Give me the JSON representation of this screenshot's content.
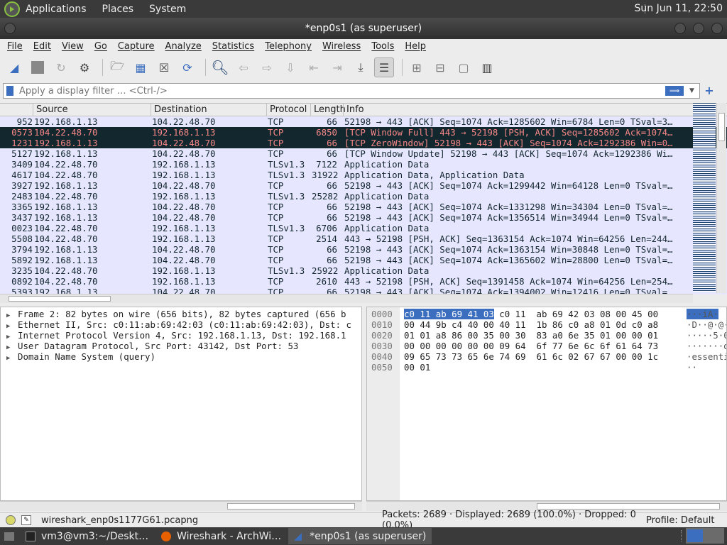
{
  "topbar": {
    "applications": "Applications",
    "places": "Places",
    "system": "System",
    "clock": "Sun Jun 11, 22:50"
  },
  "window": {
    "title": "*enp0s1 (as superuser)"
  },
  "menu": [
    "File",
    "Edit",
    "View",
    "Go",
    "Capture",
    "Analyze",
    "Statistics",
    "Telephony",
    "Wireless",
    "Tools",
    "Help"
  ],
  "toolbar": {
    "icons": [
      "shark-fin-start-icon",
      "stop-icon",
      "restart-icon",
      "capture-options-gear-icon",
      "open-file-icon",
      "save-file-icon",
      "close-file-icon",
      "reload-icon",
      "find-packet-search-icon",
      "go-back-icon",
      "go-forward-icon",
      "go-to-packet-icon",
      "first-packet-icon",
      "last-packet-icon",
      "autoscroll-icon",
      "colorize-icon",
      "zoom-in-icon",
      "zoom-out-icon",
      "normal-size-icon",
      "resize-columns-icon"
    ]
  },
  "filter": {
    "placeholder": "Apply a display filter … <Ctrl-/>"
  },
  "packet_list": {
    "columns": [
      "",
      "Source",
      "Destination",
      "Protocol",
      "Length",
      "Info"
    ],
    "rows": [
      {
        "no": "952",
        "src": "192.168.1.13",
        "dst": "104.22.48.70",
        "proto": "TCP",
        "len": "66",
        "info": "52198 → 443 [ACK] Seq=1074 Ack=1285602 Win=6784 Len=0 TSval=3…",
        "style": "normal"
      },
      {
        "no": "0573",
        "src": "104.22.48.70",
        "dst": "192.168.1.13",
        "proto": "TCP",
        "len": "6850",
        "info": "[TCP Window Full] 443 → 52198 [PSH, ACK] Seq=1285602 Ack=1074…",
        "style": "bad"
      },
      {
        "no": "1231",
        "src": "192.168.1.13",
        "dst": "104.22.48.70",
        "proto": "TCP",
        "len": "66",
        "info": "[TCP ZeroWindow] 52198 → 443 [ACK] Seq=1074 Ack=1292386 Win=0…",
        "style": "bad"
      },
      {
        "no": "5127",
        "src": "192.168.1.13",
        "dst": "104.22.48.70",
        "proto": "TCP",
        "len": "66",
        "info": "[TCP Window Update] 52198 → 443 [ACK] Seq=1074 Ack=1292386 Wi…",
        "style": "normal"
      },
      {
        "no": "3409",
        "src": "104.22.48.70",
        "dst": "192.168.1.13",
        "proto": "TLSv1.3",
        "len": "7122",
        "info": "Application Data",
        "style": "normal"
      },
      {
        "no": "4617",
        "src": "104.22.48.70",
        "dst": "192.168.1.13",
        "proto": "TLSv1.3",
        "len": "31922",
        "info": "Application Data, Application Data",
        "style": "normal"
      },
      {
        "no": "3927",
        "src": "192.168.1.13",
        "dst": "104.22.48.70",
        "proto": "TCP",
        "len": "66",
        "info": "52198 → 443 [ACK] Seq=1074 Ack=1299442 Win=64128 Len=0 TSval=…",
        "style": "normal"
      },
      {
        "no": "2483",
        "src": "104.22.48.70",
        "dst": "192.168.1.13",
        "proto": "TLSv1.3",
        "len": "25282",
        "info": "Application Data",
        "style": "normal"
      },
      {
        "no": "3365",
        "src": "192.168.1.13",
        "dst": "104.22.48.70",
        "proto": "TCP",
        "len": "66",
        "info": "52198 → 443 [ACK] Seq=1074 Ack=1331298 Win=34304 Len=0 TSval=…",
        "style": "normal"
      },
      {
        "no": "3437",
        "src": "192.168.1.13",
        "dst": "104.22.48.70",
        "proto": "TCP",
        "len": "66",
        "info": "52198 → 443 [ACK] Seq=1074 Ack=1356514 Win=34944 Len=0 TSval=…",
        "style": "normal"
      },
      {
        "no": "0023",
        "src": "104.22.48.70",
        "dst": "192.168.1.13",
        "proto": "TLSv1.3",
        "len": "6706",
        "info": "Application Data",
        "style": "normal"
      },
      {
        "no": "5508",
        "src": "104.22.48.70",
        "dst": "192.168.1.13",
        "proto": "TCP",
        "len": "2514",
        "info": "443 → 52198 [PSH, ACK] Seq=1363154 Ack=1074 Win=64256 Len=244…",
        "style": "normal"
      },
      {
        "no": "3794",
        "src": "192.168.1.13",
        "dst": "104.22.48.70",
        "proto": "TCP",
        "len": "66",
        "info": "52198 → 443 [ACK] Seq=1074 Ack=1363154 Win=30848 Len=0 TSval=…",
        "style": "normal"
      },
      {
        "no": "5892",
        "src": "192.168.1.13",
        "dst": "104.22.48.70",
        "proto": "TCP",
        "len": "66",
        "info": "52198 → 443 [ACK] Seq=1074 Ack=1365602 Win=28800 Len=0 TSval=…",
        "style": "normal"
      },
      {
        "no": "3235",
        "src": "104.22.48.70",
        "dst": "192.168.1.13",
        "proto": "TLSv1.3",
        "len": "25922",
        "info": "Application Data",
        "style": "normal"
      },
      {
        "no": "0892",
        "src": "104.22.48.70",
        "dst": "192.168.1.13",
        "proto": "TCP",
        "len": "2610",
        "info": "443 → 52198 [PSH, ACK] Seq=1391458 Ack=1074 Win=64256 Len=254…",
        "style": "normal"
      },
      {
        "no": "5393",
        "src": "192.168.1.13",
        "dst": "104.22.48.70",
        "proto": "TCP",
        "len": "66",
        "info": "52198 → 443 [ACK] Seq=1074 Ack=1394002 Win=12416 Len=0 TSval=…",
        "style": "normal"
      }
    ]
  },
  "details": [
    "Frame 2: 82 bytes on wire (656 bits), 82 bytes captured (656 b",
    "Ethernet II, Src: c0:11:ab:69:42:03 (c0:11:ab:69:42:03), Dst: c",
    "Internet Protocol Version 4, Src: 192.168.1.13, Dst: 192.168.1",
    "User Datagram Protocol, Src Port: 43142, Dst Port: 53",
    "Domain Name System (query)"
  ],
  "bytes": [
    {
      "off": "0000",
      "hl": "c0 11 ab 69 41 03",
      "hex": " c0 11  ab 69 42 03 08 00 45 00",
      "asc": "···iA·"
    },
    {
      "off": "0010",
      "hl": "",
      "hex": "00 44 9b c4 40 00 40 11  1b 86 c0 a8 01 0d c0 a8",
      "asc": "·D··@·@·"
    },
    {
      "off": "0020",
      "hl": "",
      "hex": "01 01 a8 86 00 35 00 30  83 a0 6e 35 01 00 00 01",
      "asc": "·····5·0"
    },
    {
      "off": "0030",
      "hl": "",
      "hex": "00 00 00 00 00 00 09 64  6f 77 6e 6c 6f 61 64 73",
      "asc": "·······d"
    },
    {
      "off": "0040",
      "hl": "",
      "hex": "09 65 73 73 65 6e 74 69  61 6c 02 67 67 00 00 1c",
      "asc": "·essenti"
    },
    {
      "off": "0050",
      "hl": "",
      "hex": "00 01",
      "asc": "··"
    }
  ],
  "status": {
    "file": "wireshark_enp0s1177G61.pcapng",
    "packets": "Packets: 2689 · Displayed: 2689 (100.0%) · Dropped: 0 (0.0%)",
    "profile": "Profile: Default"
  },
  "taskbar": [
    {
      "label": "vm3@vm3:~/Deskt…",
      "icon": "terminal-icon",
      "active": false
    },
    {
      "label": "Wireshark - ArchWi…",
      "icon": "firefox-icon",
      "active": false
    },
    {
      "label": "*enp0s1 (as superuser)",
      "icon": "wireshark-icon",
      "active": true
    }
  ],
  "colors": {
    "row_normal": "#e7e6ff",
    "row_bad_bg": "#12272e",
    "row_bad_fg": "#f78787",
    "accent": "#3c6ebf"
  }
}
